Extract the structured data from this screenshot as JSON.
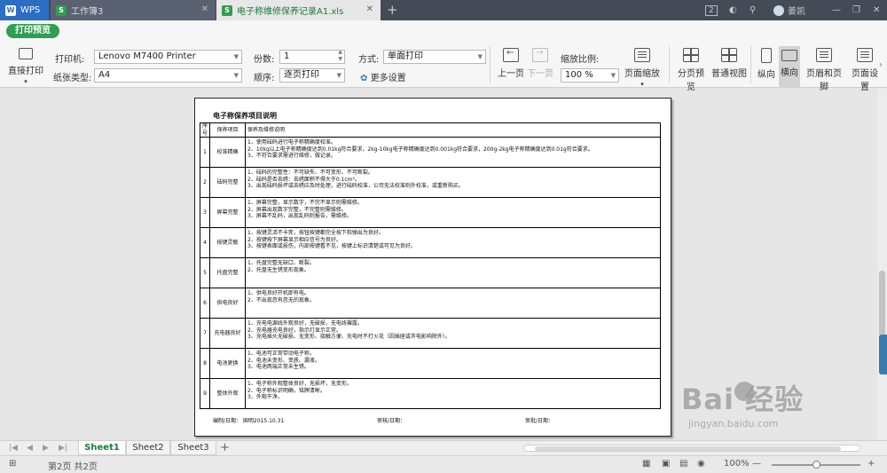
{
  "titlebar": {
    "tabs": [
      {
        "label": "WPS"
      },
      {
        "label": "工作簿3"
      },
      {
        "label": "电子称维修保养记录A1.xls"
      }
    ],
    "badge": "2",
    "user": "姜凯"
  },
  "print_preview_label": "打印预览",
  "ribbon": {
    "direct_print": "直接打印",
    "printer_label": "打印机:",
    "printer_value": "Lenovo M7400 Printer",
    "paper_type_label": "纸张类型:",
    "paper_type_value": "A4",
    "copies_label": "份数:",
    "copies_value": "1",
    "order_label": "顺序:",
    "order_value": "逐页打印",
    "mode_label": "方式:",
    "mode_value": "单面打印",
    "more_settings": "更多设置",
    "prev_page": "上一页",
    "next_page": "下一页",
    "zoom_label": "缩放比例:",
    "zoom_value": "100 %",
    "page_zoom": "页面缩放",
    "page_break_preview": "分页预览",
    "normal_view": "普通视图",
    "portrait": "纵向",
    "landscape": "横向",
    "header_footer": "页眉和页脚",
    "page_setup": "页面设置"
  },
  "document": {
    "title": "电子称保养项目说明",
    "header": {
      "no": "序号",
      "item": "保养项目",
      "desc": "保养及维修说明"
    },
    "rows": [
      {
        "no": "1",
        "item": "校准精确",
        "desc": [
          "1、使用砝码进行电子称精确度校准。",
          "2、10kg以上电子称精确度达到0.01kg符合要求，2kg-10kg电子称精确度达到0.001kg符合要求，200g-2kg电子称精确度达到0.01g符合要求。",
          "3、不符合要求需进行维修，做记录。"
        ]
      },
      {
        "no": "2",
        "item": "砝码完整",
        "desc": [
          "1、砝码的完整性：不可缺失、不可变形、不可断裂。",
          "2、砝码是否去绣：去绣面积不得大于0.1cm²。",
          "3、出现砝码损坏或去绣应及时处理，进行砝码校准，公司无法校准则外校准，或重新购买。"
        ]
      },
      {
        "no": "3",
        "item": "屏幕完整",
        "desc": [
          "1、屏幕完整，显示数字，不完不显示则需维修。",
          "2、屏幕出现数字完整，不完整则需维修。",
          "3、屏幕不乱码，出现乱码则报告，需维修。"
        ]
      },
      {
        "no": "4",
        "item": "按键灵敏",
        "desc": [
          "1、按键灵活不卡死，按钮按键都完全按下和弹出为良好。",
          "2、按键按下屏幕显示相应信号为良好。",
          "3、按键表面或损伤，内部按键看不见，按键上标识清楚或可见为良好。"
        ]
      },
      {
        "no": "5",
        "item": "托盘完整",
        "desc": [
          "1、托盘完整无缺口、断裂。",
          "2、托盘无生锈变形现象。"
        ]
      },
      {
        "no": "6",
        "item": "供电良好",
        "desc": [
          "1、供电良好开机即有电。",
          "2、不出现忽有忽无的现象。"
        ]
      },
      {
        "no": "7",
        "item": "充电器良好",
        "desc": [
          "1、充电电源线外观良好，无破损，无电线裸露。",
          "2、充电器充电良好，指示灯显示正常。",
          "3、充电插头无破损、无变形、接触方便、充电时不打火花（因插座或市电影响除外）。"
        ]
      },
      {
        "no": "8",
        "item": "电池更换",
        "desc": [
          "1、电池可正常带动电子称。",
          "2、电池未变形、变质、漏液。",
          "3、电池两端正常未生锈。"
        ]
      },
      {
        "no": "9",
        "item": "整体外观",
        "desc": [
          "1、电子称外观整体良好，无损坏，无变形。",
          "2、电子称标识明确，铭牌清晰。",
          "3、外观干净。"
        ]
      }
    ],
    "sign": {
      "author": "编制/日期：  国明2015.10.31",
      "reviewer": "审核/日期：",
      "approver": "审批/日期："
    }
  },
  "sheets": [
    "Sheet1",
    "Sheet2",
    "Sheet3"
  ],
  "active_sheet": "Sheet1",
  "status": {
    "page_info": "第2页 共2页",
    "zoom": "100%"
  },
  "watermark": {
    "main": "Bai  经验",
    "sub": "jingyan.baidu.com"
  }
}
